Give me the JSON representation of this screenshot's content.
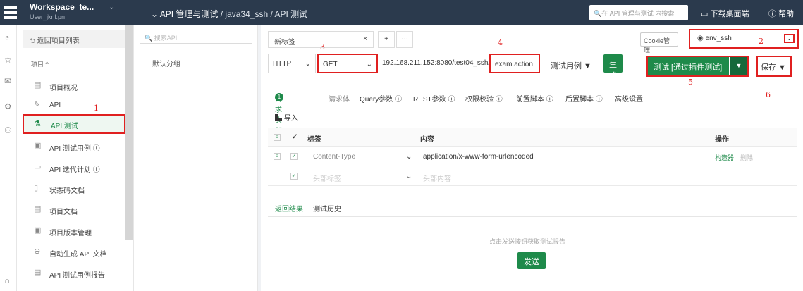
{
  "topbar": {
    "workspace_name": "Workspace_te...",
    "workspace_user": "User_jknl.pn",
    "nav_label": "API 管理与测试",
    "breadcrumb": "/ java34_ssh / API 测试",
    "search_placeholder": "在 API 管理与测试 内搜索",
    "download_label": "下载桌面端",
    "help_label": "帮助"
  },
  "sidebar": {
    "back_label": "返回项目列表",
    "project_label": "项目 ^",
    "items": [
      {
        "label": "项目概况",
        "icon": "grid-icon"
      },
      {
        "label": "API",
        "icon": "pencil-icon"
      },
      {
        "label": "API 测试",
        "icon": "flask-icon",
        "active": true
      },
      {
        "label": "API 测试用例 ⓘ",
        "icon": "case-icon"
      },
      {
        "label": "API 迭代计划 ⓘ",
        "icon": "plan-icon"
      },
      {
        "label": "状态码文档",
        "icon": "doc-icon"
      },
      {
        "label": "项目文档",
        "icon": "doc-icon"
      },
      {
        "label": "项目版本管理",
        "icon": "version-icon"
      },
      {
        "label": "自动生成 API 文档",
        "icon": "robot-icon"
      },
      {
        "label": "API 测试用例报告",
        "icon": "report-icon"
      }
    ]
  },
  "groups": {
    "search_placeholder": "搜索API",
    "default_group": "默认分组"
  },
  "tabs": {
    "new_tab": "新标签",
    "add": "+",
    "more": "···",
    "cookie": "Cookie管理",
    "env": "env_ssh"
  },
  "request": {
    "protocol": "HTTP",
    "method": "GET",
    "url": "192.168.211.152:8080/test04_ssh/",
    "path": "exam.action",
    "case_label": "测试用例 ▼",
    "gen_code": "生成代码",
    "test_label": "测试 [通过插件测试]",
    "save_label": "保存 ▼"
  },
  "param_tabs": [
    "请求头部",
    "请求体",
    "Query参数 ⓘ",
    "REST参数 ⓘ",
    "权限校验 ⓘ",
    "前置脚本 ⓘ",
    "后置脚本 ⓘ",
    "高级设置"
  ],
  "header_count": "1",
  "import_label": "导入",
  "table": {
    "col_label": "标签",
    "col_content": "内容",
    "col_ops": "操作",
    "rows": [
      {
        "label": "Content-Type",
        "content": "application/x-www-form-urlencoded",
        "op1": "构造器",
        "op2": "删除"
      },
      {
        "label": "头部标签",
        "content": "头部内容"
      }
    ]
  },
  "result_tabs": [
    "返回结果",
    "测试历史"
  ],
  "result_hint": "点击发送按钮获取测试报告",
  "send_label": "发送",
  "annotations": [
    "1",
    "2",
    "3",
    "4",
    "5",
    "6"
  ],
  "colors": {
    "brand": "#1e8a4a",
    "topbar": "#2b3a4d",
    "annotation": "#e02020"
  }
}
